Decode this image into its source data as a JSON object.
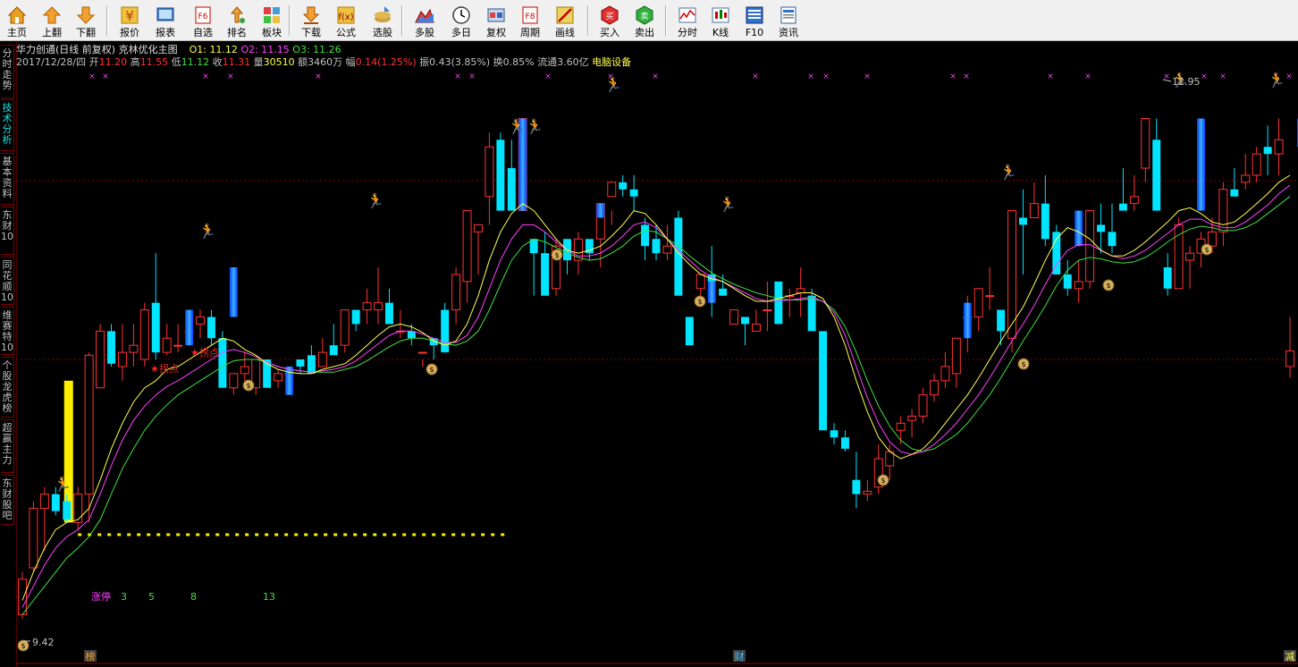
{
  "toolbar": {
    "items": [
      {
        "label": "主页",
        "icon": "home-icon"
      },
      {
        "label": "上翻",
        "icon": "arrow-up-icon"
      },
      {
        "label": "下翻",
        "icon": "arrow-down-icon"
      },
      {
        "label": "报价",
        "icon": "yen-icon"
      },
      {
        "label": "报表",
        "icon": "report-icon"
      },
      {
        "label": "自选",
        "icon": "f6-icon"
      },
      {
        "label": "排名",
        "icon": "rank-icon"
      },
      {
        "label": "板块",
        "icon": "sector-icon"
      },
      {
        "label": "下载",
        "icon": "download-icon"
      },
      {
        "label": "公式",
        "icon": "formula-icon"
      },
      {
        "label": "选股",
        "icon": "stock-pick-icon"
      },
      {
        "label": "多股",
        "icon": "multi-stock-icon"
      },
      {
        "label": "多日",
        "icon": "clock-icon"
      },
      {
        "label": "复权",
        "icon": "restore-rights-icon"
      },
      {
        "label": "周期",
        "icon": "f8-icon"
      },
      {
        "label": "画线",
        "icon": "draw-line-icon"
      },
      {
        "label": "买入",
        "icon": "buy-icon"
      },
      {
        "label": "卖出",
        "icon": "sell-icon"
      },
      {
        "label": "分时",
        "icon": "timeshare-icon"
      },
      {
        "label": "K线",
        "icon": "kline-icon"
      },
      {
        "label": "F10",
        "icon": "f10-icon"
      },
      {
        "label": "资讯",
        "icon": "news-icon"
      }
    ]
  },
  "sidebar": {
    "tabs": [
      "分时走势",
      "技术分析",
      "基本资料",
      "东财10",
      "同花顺10",
      "维赛特10",
      "个股龙虎榜",
      "超赢主力",
      "东财股吧"
    ],
    "active_index": 1
  },
  "header": {
    "title": "华力创通(日线 前复权) 克林优化主图",
    "o1": "O1: 11.12",
    "o2": "O2: 11.15",
    "o3": "O3: 11.26",
    "date": "2017/12/28/四",
    "open_label": "开",
    "open": "11.20",
    "high_label": "高",
    "high": "11.55",
    "low_label": "低",
    "low": "11.12",
    "close_label": "收",
    "close": "11.31",
    "vol_label": "量",
    "vol": "30510",
    "amt_label": "额",
    "amt": "3460万",
    "chg_label": "幅",
    "chg": "0.14(1.25%)",
    "amp": "振0.43(3.85%)",
    "turnover": "换0.85%",
    "float": "流通3.60亿",
    "sector": "电脑设备"
  },
  "annotations": {
    "inflection1": "拐点",
    "inflection2": "拐点",
    "limit_up_label": "涨停",
    "limit_up_counts": [
      "3",
      "5",
      "8",
      "13"
    ],
    "low_price": "9.42",
    "high_price": "12.95",
    "bottom_markers": [
      "榜",
      "财",
      "减"
    ]
  },
  "colors": {
    "up": "#ff3232",
    "down": "#00e4ff",
    "ma1": "#ffff50",
    "ma2": "#ff40ff",
    "ma3": "#40e040",
    "limitup": "#ffee00",
    "grid": "#8a0000"
  },
  "chart_data": {
    "type": "candlestick",
    "price_range": [
      9.2,
      13.25
    ],
    "extremes": {
      "low": 9.42,
      "high": 12.95
    },
    "ohlc": [
      [
        9.45,
        9.75,
        9.42,
        9.7
      ],
      [
        9.78,
        10.25,
        9.75,
        10.2
      ],
      [
        10.2,
        10.35,
        9.9,
        10.3
      ],
      [
        10.3,
        10.35,
        10.15,
        10.18
      ],
      [
        10.25,
        10.3,
        10.1,
        10.12
      ],
      [
        10.1,
        10.35,
        10.05,
        10.3
      ],
      [
        10.3,
        11.3,
        10.1,
        11.28
      ],
      [
        11.05,
        11.5,
        11.1,
        11.45
      ],
      [
        11.45,
        11.5,
        11.2,
        11.22
      ],
      [
        11.2,
        11.5,
        11.1,
        11.3
      ],
      [
        11.3,
        11.5,
        11.2,
        11.35
      ],
      [
        11.25,
        11.65,
        11.2,
        11.6
      ],
      [
        11.65,
        12.0,
        11.25,
        11.3
      ],
      [
        11.3,
        11.5,
        11.28,
        11.4
      ],
      [
        11.35,
        11.5,
        11.3,
        11.35
      ],
      [
        11.45,
        11.5,
        11.35,
        11.45
      ],
      [
        11.5,
        11.6,
        11.4,
        11.55
      ],
      [
        11.55,
        11.6,
        11.35,
        11.4
      ],
      [
        11.4,
        11.45,
        11.1,
        11.05
      ],
      [
        11.05,
        11.15,
        11.0,
        11.15
      ],
      [
        11.15,
        11.3,
        11.1,
        11.2
      ],
      [
        11.05,
        11.25,
        11.0,
        11.25
      ],
      [
        11.25,
        11.25,
        11.05,
        11.05
      ],
      [
        11.1,
        11.18,
        11.05,
        11.15
      ],
      [
        11.15,
        11.2,
        11.1,
        11.15
      ],
      [
        11.25,
        11.22,
        11.15,
        11.2
      ],
      [
        11.28,
        11.35,
        11.25,
        11.15
      ],
      [
        11.2,
        11.4,
        11.25,
        11.3
      ],
      [
        11.35,
        11.5,
        11.3,
        11.28
      ],
      [
        11.35,
        11.55,
        11.3,
        11.6
      ],
      [
        11.6,
        11.5,
        11.45,
        11.5
      ],
      [
        11.6,
        11.75,
        11.5,
        11.65
      ],
      [
        11.6,
        11.9,
        11.5,
        11.65
      ],
      [
        11.65,
        11.75,
        11.55,
        11.5
      ],
      [
        11.45,
        11.6,
        11.4,
        11.45
      ],
      [
        11.45,
        11.5,
        11.35,
        11.4
      ],
      [
        11.3,
        11.25,
        11.2,
        11.3
      ],
      [
        11.4,
        11.35,
        11.25,
        11.35
      ],
      [
        11.6,
        11.65,
        11.3,
        11.3
      ],
      [
        11.6,
        11.9,
        11.5,
        11.85
      ],
      [
        11.8,
        12.3,
        11.65,
        12.3
      ],
      [
        12.15,
        12.2,
        11.85,
        12.2
      ],
      [
        12.4,
        12.85,
        12.2,
        12.75
      ],
      [
        12.8,
        12.85,
        12.3,
        12.3
      ],
      [
        12.6,
        12.8,
        12.35,
        12.3
      ],
      [
        12.3,
        12.95,
        12.3,
        12.95
      ],
      [
        12.1,
        12.05,
        11.7,
        12.0
      ],
      [
        12.0,
        12.15,
        11.75,
        11.7
      ],
      [
        11.75,
        12.1,
        11.7,
        12.05
      ],
      [
        12.1,
        12.1,
        11.85,
        11.95
      ],
      [
        11.95,
        12.15,
        11.85,
        12.1
      ],
      [
        12.1,
        12.05,
        11.95,
        12.0
      ],
      [
        12.1,
        12.15,
        11.9,
        12.35
      ],
      [
        12.4,
        12.3,
        12.2,
        12.5
      ],
      [
        12.5,
        12.55,
        12.4,
        12.45
      ],
      [
        12.45,
        12.55,
        12.3,
        12.4
      ],
      [
        12.2,
        12.25,
        11.95,
        12.05
      ],
      [
        12.1,
        12.2,
        11.95,
        12.0
      ],
      [
        12.0,
        12.2,
        11.95,
        12.05
      ],
      [
        12.25,
        12.3,
        11.75,
        11.7
      ],
      [
        11.55,
        11.5,
        11.35,
        11.35
      ],
      [
        11.75,
        11.8,
        11.7,
        11.85
      ],
      [
        11.85,
        12.05,
        11.55,
        11.8
      ],
      [
        11.75,
        11.85,
        11.7,
        11.7
      ],
      [
        11.5,
        11.5,
        11.6,
        11.6
      ],
      [
        11.55,
        11.5,
        11.35,
        11.5
      ],
      [
        11.45,
        11.6,
        11.45,
        11.5
      ],
      [
        11.6,
        11.8,
        11.45,
        11.6
      ],
      [
        11.8,
        11.75,
        11.5,
        11.5
      ],
      [
        11.7,
        11.75,
        11.55,
        11.7
      ],
      [
        11.72,
        11.9,
        11.55,
        11.75
      ],
      [
        11.7,
        11.75,
        11.6,
        11.45
      ],
      [
        11.45,
        11.3,
        10.8,
        10.75
      ],
      [
        10.75,
        10.8,
        10.65,
        10.7
      ],
      [
        10.7,
        10.75,
        10.6,
        10.62
      ],
      [
        10.4,
        10.6,
        10.2,
        10.3
      ],
      [
        10.3,
        10.4,
        10.25,
        10.32
      ],
      [
        10.35,
        10.65,
        10.3,
        10.55
      ],
      [
        10.5,
        10.65,
        10.4,
        10.6
      ],
      [
        10.75,
        10.85,
        10.65,
        10.8
      ],
      [
        10.82,
        10.9,
        10.7,
        10.85
      ],
      [
        10.85,
        11.05,
        10.8,
        11.0
      ],
      [
        11.0,
        11.15,
        10.95,
        11.1
      ],
      [
        11.1,
        11.3,
        11.05,
        11.2
      ],
      [
        11.15,
        11.4,
        11.05,
        11.4
      ],
      [
        11.55,
        11.7,
        11.3,
        11.55
      ],
      [
        11.55,
        11.75,
        11.45,
        11.75
      ],
      [
        11.7,
        11.9,
        11.6,
        11.7
      ],
      [
        11.6,
        11.45,
        11.35,
        11.45
      ],
      [
        11.4,
        12.0,
        11.3,
        12.3
      ],
      [
        12.25,
        12.45,
        11.85,
        12.2
      ],
      [
        12.25,
        12.5,
        12.3,
        12.35
      ],
      [
        12.35,
        12.55,
        12.05,
        12.1
      ],
      [
        12.15,
        12.2,
        11.95,
        11.85
      ],
      [
        11.85,
        11.95,
        11.7,
        11.75
      ],
      [
        11.75,
        11.95,
        11.65,
        11.8
      ],
      [
        11.8,
        12.3,
        11.75,
        12.3
      ],
      [
        12.2,
        12.35,
        12.0,
        12.15
      ],
      [
        12.15,
        12.35,
        12.0,
        12.05
      ],
      [
        12.35,
        12.6,
        12.3,
        12.3
      ],
      [
        12.35,
        12.55,
        12.3,
        12.4
      ],
      [
        12.6,
        12.95,
        12.5,
        12.95
      ],
      [
        12.8,
        12.95,
        12.3,
        12.3
      ],
      [
        11.9,
        12.0,
        11.7,
        11.75
      ],
      [
        11.75,
        12.25,
        11.85,
        12.2
      ],
      [
        11.95,
        12.05,
        11.75,
        12.0
      ],
      [
        12.0,
        12.15,
        11.9,
        12.1
      ],
      [
        12.05,
        12.25,
        12.0,
        12.15
      ],
      [
        12.15,
        12.5,
        12.05,
        12.45
      ],
      [
        12.45,
        12.6,
        12.4,
        12.4
      ],
      [
        12.5,
        12.7,
        12.45,
        12.55
      ],
      [
        12.55,
        12.75,
        12.5,
        12.7
      ],
      [
        12.75,
        12.9,
        12.55,
        12.7
      ],
      [
        12.7,
        12.95,
        12.55,
        12.8
      ],
      [
        11.2,
        11.55,
        11.12,
        11.31
      ]
    ],
    "ma_fast": [
      9.55,
      9.75,
      9.92,
      10.05,
      10.1,
      10.12,
      10.2,
      10.4,
      10.62,
      10.8,
      10.95,
      11.05,
      11.1,
      11.18,
      11.2,
      11.25,
      11.3,
      11.35,
      11.4,
      11.38,
      11.32,
      11.28,
      11.22,
      11.18,
      11.16,
      11.15,
      11.15,
      11.18,
      11.2,
      11.22,
      11.28,
      11.35,
      11.42,
      11.48,
      11.5,
      11.48,
      11.44,
      11.38,
      11.35,
      11.38,
      11.5,
      11.7,
      11.95,
      12.15,
      12.28,
      12.35,
      12.3,
      12.2,
      12.1,
      12.02,
      12.0,
      12.02,
      12.05,
      12.12,
      12.2,
      12.3,
      12.28,
      12.2,
      12.1,
      12.0,
      11.92,
      11.85,
      11.82,
      11.8,
      11.75,
      11.7,
      11.66,
      11.66,
      11.68,
      11.7,
      11.72,
      11.72,
      11.68,
      11.55,
      11.35,
      11.1,
      10.88,
      10.7,
      10.6,
      10.55,
      10.58,
      10.62,
      10.7,
      10.8,
      10.9,
      11.0,
      11.12,
      11.25,
      11.38,
      11.5,
      11.62,
      11.78,
      11.95,
      12.1,
      12.18,
      12.15,
      12.1,
      12.02,
      11.98,
      11.98,
      12.02,
      12.08,
      12.15,
      12.22,
      12.3,
      12.32,
      12.28,
      12.22,
      12.2,
      12.22,
      12.28,
      12.35,
      12.42,
      12.5,
      12.55
    ],
    "ma_mid": [
      9.5,
      9.65,
      9.8,
      9.92,
      10.0,
      10.05,
      10.12,
      10.3,
      10.5,
      10.68,
      10.82,
      10.92,
      11.0,
      11.06,
      11.1,
      11.15,
      11.2,
      11.25,
      11.3,
      11.32,
      11.3,
      11.27,
      11.23,
      11.2,
      11.18,
      11.17,
      11.16,
      11.17,
      11.18,
      11.2,
      11.24,
      11.3,
      11.36,
      11.42,
      11.45,
      11.45,
      11.43,
      11.4,
      11.37,
      11.37,
      11.42,
      11.55,
      11.75,
      11.95,
      12.1,
      12.2,
      12.2,
      12.15,
      12.08,
      12.02,
      11.98,
      11.98,
      12.0,
      12.05,
      12.12,
      12.2,
      12.22,
      12.18,
      12.1,
      12.02,
      11.95,
      11.88,
      11.83,
      11.8,
      11.76,
      11.72,
      11.68,
      11.66,
      11.66,
      11.67,
      11.68,
      11.69,
      11.66,
      11.58,
      11.42,
      11.2,
      10.98,
      10.8,
      10.67,
      10.6,
      10.58,
      10.6,
      10.65,
      10.72,
      10.8,
      10.9,
      11.0,
      11.12,
      11.25,
      11.38,
      11.5,
      11.63,
      11.78,
      11.92,
      12.02,
      12.06,
      12.06,
      12.02,
      11.98,
      11.96,
      11.98,
      12.02,
      12.08,
      12.14,
      12.2,
      12.24,
      12.24,
      12.2,
      12.18,
      12.18,
      12.22,
      12.28,
      12.34,
      12.42,
      12.48
    ],
    "ma_slow": [
      9.45,
      9.55,
      9.65,
      9.75,
      9.85,
      9.92,
      10.0,
      10.12,
      10.3,
      10.48,
      10.62,
      10.75,
      10.85,
      10.93,
      11.0,
      11.05,
      11.1,
      11.15,
      11.2,
      11.24,
      11.25,
      11.25,
      11.23,
      11.2,
      11.18,
      11.17,
      11.16,
      11.16,
      11.16,
      11.18,
      11.2,
      11.24,
      11.29,
      11.34,
      11.38,
      11.4,
      11.4,
      11.38,
      11.36,
      11.35,
      11.38,
      11.45,
      11.6,
      11.78,
      11.95,
      12.05,
      12.1,
      12.08,
      12.04,
      12.0,
      11.97,
      11.95,
      11.96,
      12.0,
      12.05,
      12.12,
      12.16,
      12.15,
      12.1,
      12.05,
      11.98,
      11.92,
      11.86,
      11.82,
      11.78,
      11.75,
      11.72,
      11.7,
      11.68,
      11.67,
      11.67,
      11.68,
      11.66,
      11.6,
      11.48,
      11.3,
      11.1,
      10.92,
      10.78,
      10.68,
      10.62,
      10.6,
      10.62,
      10.67,
      10.72,
      10.8,
      10.9,
      11.0,
      11.12,
      11.25,
      11.38,
      11.5,
      11.63,
      11.77,
      11.88,
      11.95,
      11.97,
      11.96,
      11.94,
      11.93,
      11.94,
      11.97,
      12.02,
      12.08,
      12.13,
      12.17,
      12.19,
      12.18,
      12.16,
      12.16,
      12.18,
      12.22,
      12.28,
      12.34,
      12.4
    ]
  }
}
